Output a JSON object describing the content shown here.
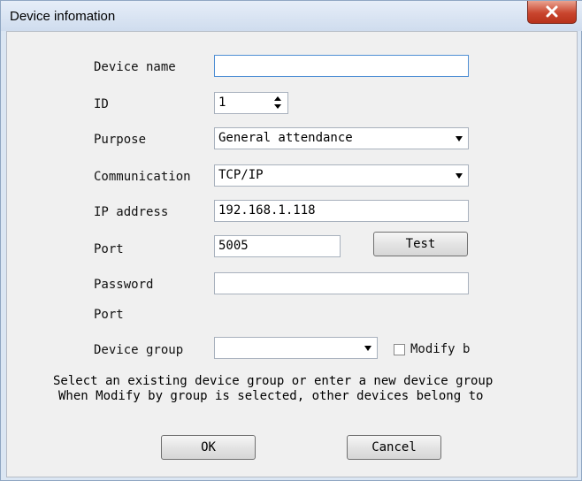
{
  "window": {
    "title": "Device infomation"
  },
  "fields": {
    "device_name": {
      "label": "Device name",
      "value": ""
    },
    "id": {
      "label": "ID",
      "value": "1"
    },
    "purpose": {
      "label": "Purpose",
      "value": "General attendance"
    },
    "communication": {
      "label": "Communication",
      "value": "TCP/IP"
    },
    "ip_address": {
      "label": "IP address",
      "value": "192.168.1.118"
    },
    "port": {
      "label": "Port",
      "value": "5005"
    },
    "password": {
      "label": "Password",
      "value": ""
    },
    "port2": {
      "label": "Port"
    },
    "device_group": {
      "label": "Device group",
      "value": ""
    }
  },
  "test_button": "Test",
  "modify_checkbox": {
    "label": "Modify b",
    "checked": false
  },
  "info_lines": [
    "Select an existing device group or enter a new device group",
    "When Modify by group is selected, other devices belong to"
  ],
  "buttons": {
    "ok": "OK",
    "cancel": "Cancel"
  },
  "icons": {
    "close": "close-icon",
    "spin": "spin-arrows-icon",
    "dropdown": "dropdown-arrow-icon"
  },
  "colors": {
    "titlebar": "#dbe6f3",
    "close_button": "#c9452e",
    "focus_border": "#4f8fd4"
  }
}
